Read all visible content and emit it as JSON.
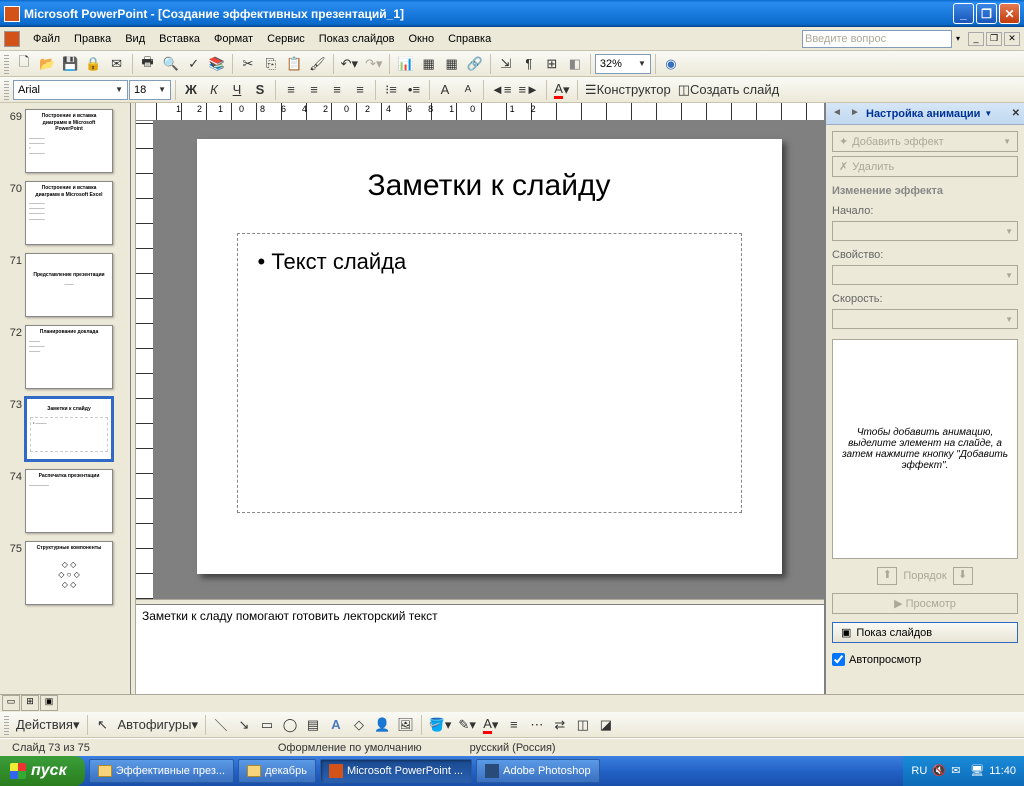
{
  "title_bar": {
    "text": "Microsoft PowerPoint - [Создание эффективных презентаций_1]"
  },
  "menu": {
    "items": [
      "Файл",
      "Правка",
      "Вид",
      "Вставка",
      "Формат",
      "Сервис",
      "Показ слайдов",
      "Окно",
      "Справка"
    ],
    "ask_placeholder": "Введите вопрос"
  },
  "toolbar_std": {
    "zoom": "32%"
  },
  "toolbar_fmt": {
    "font": "Arial",
    "size": "18",
    "designer": "Конструктор",
    "new_slide": "Создать слайд"
  },
  "ruler": {
    "h_marks": "12 10 8 6 4 2 0 2 4 6 8 10 12"
  },
  "thumbnails": [
    {
      "num": "69",
      "title": "Построение и вставка диаграмм в Microsoft PowerPoint"
    },
    {
      "num": "70",
      "title": "Построение и вставка диаграмм в Microsoft Excel"
    },
    {
      "num": "71",
      "title": "Представление презентации"
    },
    {
      "num": "72",
      "title": "Планирование доклада"
    },
    {
      "num": "73",
      "title": "Заметки к слайду",
      "selected": true
    },
    {
      "num": "74",
      "title": "Распечатка презентации"
    },
    {
      "num": "75",
      "title": "Структурные компоненты"
    }
  ],
  "slide": {
    "title": "Заметки к слайду",
    "bullet1": "Текст слайда"
  },
  "notes": {
    "text": "Заметки к сладу помогают готовить лекторский текст"
  },
  "task_pane": {
    "title": "Настройка анимации",
    "add_effect": "Добавить эффект",
    "delete": "Удалить",
    "change_effect": "Изменение эффекта",
    "start_lbl": "Начало:",
    "property_lbl": "Свойство:",
    "speed_lbl": "Скорость:",
    "hint": "Чтобы добавить анимацию, выделите элемент на слайде, а затем нажмите кнопку \"Добавить эффект\".",
    "order": "Порядок",
    "preview": "Просмотр",
    "slideshow": "Показ слайдов",
    "auto": "Автопросмотр"
  },
  "drawing": {
    "actions": "Действия",
    "autoshapes": "Автофигуры"
  },
  "status": {
    "slide_pos": "Слайд 73 из 75",
    "design": "Оформление по умолчанию",
    "lang": "русский (Россия)"
  },
  "taskbar": {
    "start": "пуск",
    "items": [
      {
        "label": "Эффективные през...",
        "icon": "folder"
      },
      {
        "label": "декабрь",
        "icon": "folder"
      },
      {
        "label": "Microsoft PowerPoint ...",
        "icon": "ppt",
        "active": true
      },
      {
        "label": "Adobe Photoshop",
        "icon": "ps"
      }
    ],
    "lang": "RU",
    "time": "11:40"
  }
}
